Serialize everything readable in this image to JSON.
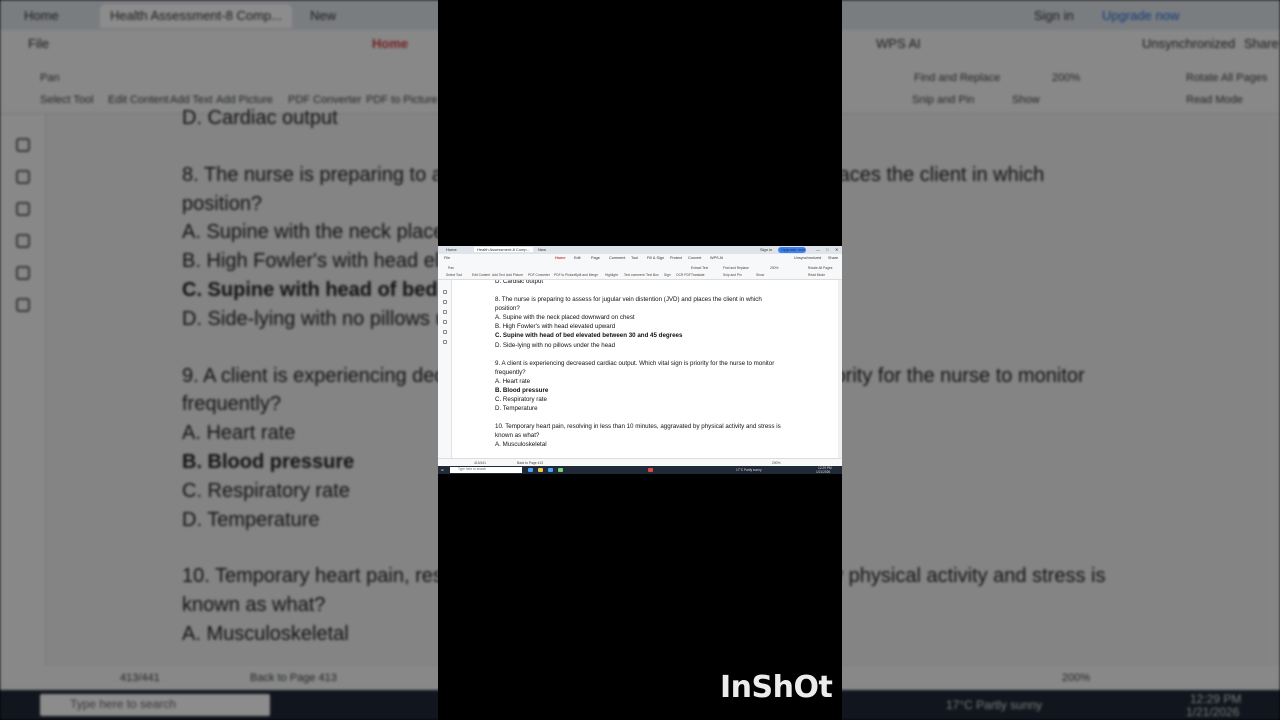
{
  "app": {
    "tabs": [
      {
        "label": "Home"
      },
      {
        "label": "Health Assessment-8 Comp..."
      },
      {
        "label": "New"
      }
    ],
    "sign_in": "Sign in",
    "upgrade": "Upgrade now",
    "menu": [
      "File",
      "Home",
      "Edit",
      "Page",
      "Comment",
      "Tool",
      "Fill & Sign",
      "Protect",
      "Convert",
      "WPS AI"
    ],
    "sync_status": "Unsynchronized",
    "share": "Share",
    "ribbon": [
      "Pan",
      "Select Tool",
      "Edit Content",
      "Add Text",
      "Add Picture",
      "PDF Converter",
      "PDF to Picture",
      "Split and Merge",
      "Highlight",
      "Text comment",
      "Text Box",
      "Sign",
      "OCR PDF",
      "Extract Text",
      "Find and Replace",
      "Show",
      "200%",
      "Rotate All Pages",
      "Snip and Pin",
      "Read Mode",
      "Translate"
    ]
  },
  "document": {
    "lines": [
      {
        "text": "D. Cardiac output",
        "bold": false,
        "gap": false
      },
      {
        "text": "8. The nurse is preparing to assess for jugular vein distention (JVD) and places the client in which",
        "bold": false,
        "gap": true
      },
      {
        "text": "position?",
        "bold": false,
        "gap": false
      },
      {
        "text": "A. Supine with the neck placed downward on chest",
        "bold": false,
        "gap": false
      },
      {
        "text": "B. High Fowler's with head elevated upward",
        "bold": false,
        "gap": false
      },
      {
        "text": "C. Supine with head of bed elevated between 30 and 45 degrees",
        "bold": true,
        "gap": false
      },
      {
        "text": "D. Side-lying with no pillows under the head",
        "bold": false,
        "gap": false
      },
      {
        "text": "9. A client is experiencing decreased cardiac output. Which vital sign is priority for the nurse to monitor",
        "bold": false,
        "gap": true
      },
      {
        "text": "frequently?",
        "bold": false,
        "gap": false
      },
      {
        "text": "A. Heart rate",
        "bold": false,
        "gap": false
      },
      {
        "text": "B. Blood pressure",
        "bold": true,
        "gap": false
      },
      {
        "text": "C. Respiratory rate",
        "bold": false,
        "gap": false
      },
      {
        "text": "D. Temperature",
        "bold": false,
        "gap": false
      },
      {
        "text": "10. Temporary heart pain, resolving in less than 10 minutes, aggravated by physical activity and stress is",
        "bold": false,
        "gap": true
      },
      {
        "text": "known as what?",
        "bold": false,
        "gap": false
      },
      {
        "text": "A.  Musculoskeletal",
        "bold": false,
        "gap": false
      }
    ]
  },
  "status": {
    "page": "413/441",
    "back": "Back to Page 413",
    "zoom": "200%"
  },
  "taskbar": {
    "search_placeholder": "Type here to search",
    "weather": "17°C  Partly sunny",
    "time": "12:29 PM",
    "date": "1/21/2026"
  },
  "watermark": "InShOt"
}
